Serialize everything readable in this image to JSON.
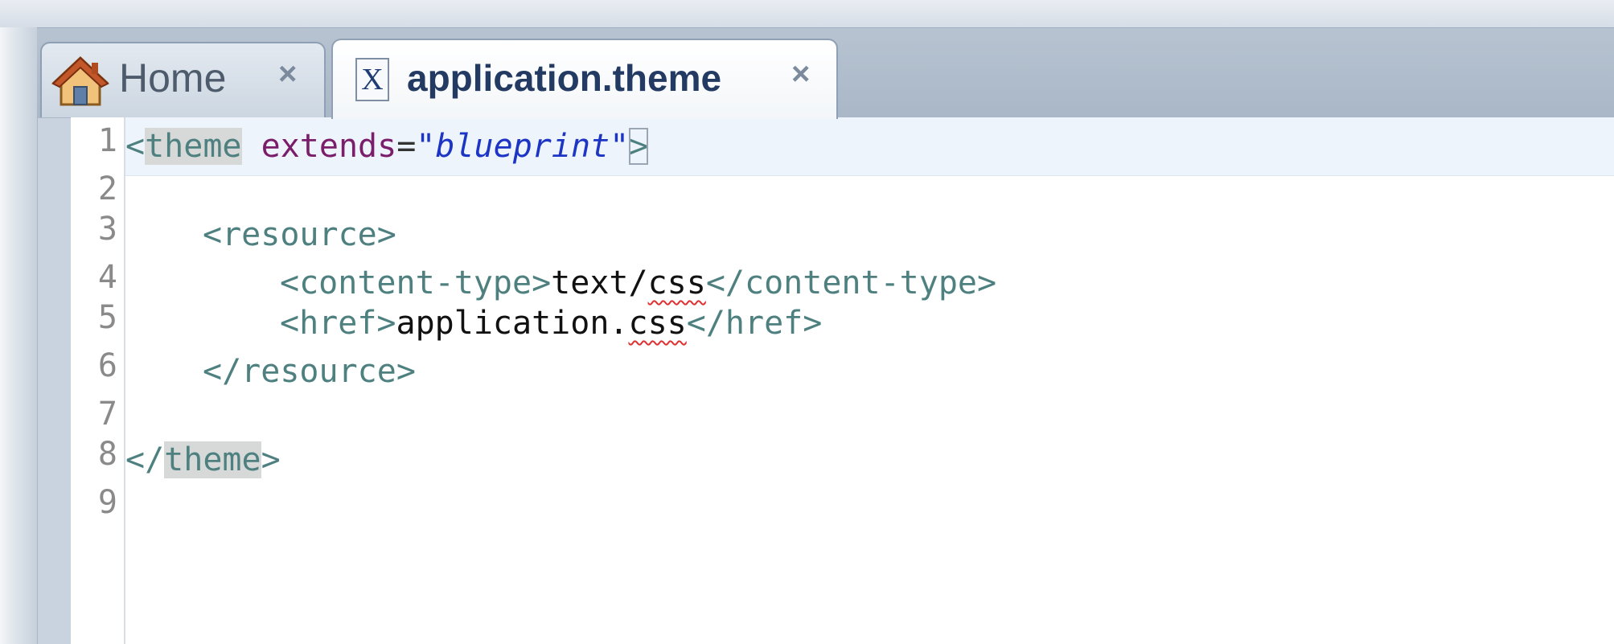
{
  "tabs": {
    "home_label": "Home",
    "file_label": "application.theme",
    "close_glyph": "×",
    "file_icon_letter": "X"
  },
  "editor": {
    "line_numbers": [
      "1",
      "2",
      "3",
      "4",
      "5",
      "6",
      "7",
      "8",
      "9"
    ],
    "lines": {
      "l1": {
        "open": "<",
        "tag": "theme",
        "space": " ",
        "attr": "extends",
        "eq": "=",
        "val": "\"blueprint\"",
        "close": ">"
      },
      "l3": {
        "text": "<resource>"
      },
      "l4": {
        "open_tag": "<content-type>",
        "text_a": "text/",
        "text_b": "css",
        "close_tag": "</content-type>"
      },
      "l5": {
        "open_tag": "<href>",
        "text_a": "application.",
        "text_b": "css",
        "close_tag": "</href>"
      },
      "l6": {
        "text": "</resource>"
      },
      "l8": {
        "open": "</",
        "tag": "theme",
        "close": ">"
      }
    }
  },
  "colors": {
    "tag": "#4f8080",
    "attribute": "#7a1d6b",
    "value": "#1d35c5",
    "text": "#111111",
    "spellcheck": "#e03030"
  },
  "icons": {
    "home_tab": "home-icon",
    "file_tab": "xml-file-icon",
    "close": "close-icon"
  }
}
